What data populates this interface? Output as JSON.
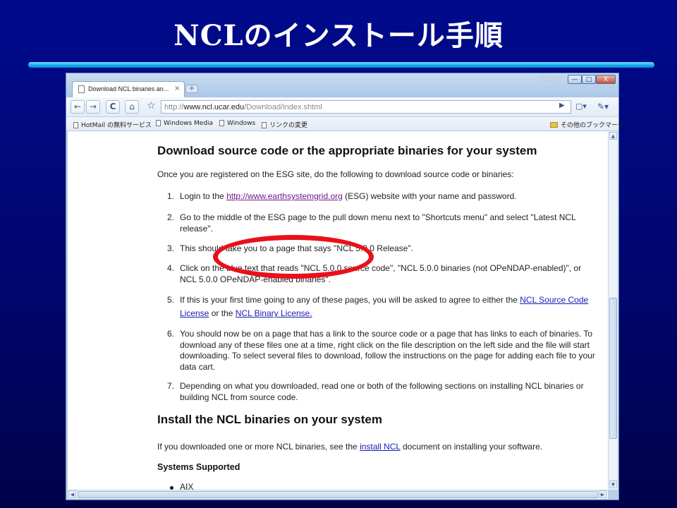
{
  "slide": {
    "title": "NCLのインストール手順"
  },
  "window": {
    "google_label": "Google",
    "minimize": "—",
    "maximize": "□",
    "close": "X"
  },
  "tab": {
    "label": "Download NCL binaries an...",
    "close": "×",
    "new_tab": "+"
  },
  "toolbar": {
    "back": "←",
    "forward": "→",
    "reload": "C",
    "home": "⌂",
    "star": "☆",
    "url_prefix": "http://",
    "url_host": "www.ncl.ucar.edu",
    "url_path": "/Download/index.shtml",
    "go": "▶",
    "page_menu": "▢▾",
    "tools_menu": "✎▾"
  },
  "bookmarks": {
    "items": [
      "HotMail の無料サービス",
      "Windows Media",
      "Windows",
      "リンクの変更"
    ],
    "other": "その他のブックマーク"
  },
  "content": {
    "heading1": "Download source code or the appropriate binaries for your system",
    "intro": "Once you are registered on the ESG site, do the following to download source code or binaries:",
    "step1": {
      "num": "1.",
      "before": "Login to the ",
      "link": "http://www.earthsystemgrid.org",
      "after": " (ESG) website with your name and password."
    },
    "step2": {
      "num": "2.",
      "line1": "Go to the middle of the ESG page to the pull down menu next to \"Shortcuts menu\" and select \"Latest NCL",
      "line2": "release\"."
    },
    "step3": {
      "num": "3.",
      "text": "This should take you to a page that says \"NCL 5.0.0 Release\"."
    },
    "step4": {
      "num": "4.",
      "line1": "Click on the blue text that reads \"NCL 5.0.0 source code\", \"NCL 5.0.0 binaries (not OPeNDAP-enabled)\", or",
      "line2": "NCL 5.0.0 OPeNDAP-enabled binaries\"."
    },
    "step5": {
      "num": "5.",
      "before": "If this is your first time going to any of these pages, you will be asked to agree to either the ",
      "link1a": "NCL Source Code",
      "link1b": "License",
      "middle": " or the ",
      "link2": "NCL Binary License."
    },
    "step6": {
      "num": "6.",
      "line1": "You should now be on a page that has a link to the source code or a page that has links to each of binaries. To",
      "line2": "download any of these files one at a time, right click on the file description on the left side and the file will start",
      "line3": "downloading. To select several files to download, follow the instructions on the page for adding each file to your",
      "line4": "data cart."
    },
    "step7": {
      "num": "7.",
      "line1": "Depending on what you downloaded, read one or both of the following sections on installing NCL binaries or",
      "line2": "building NCL from source code."
    },
    "heading2": "Install the NCL binaries on your system",
    "install_before": "If you downloaded one or more NCL binaries, see the ",
    "install_link": "install NCL",
    "install_after": " document on installing your software.",
    "heading3": "Systems Supported",
    "system1": "AIX"
  },
  "colors": {
    "slide_bg": "#000a8c",
    "accent_bar": "#18b4f0",
    "link": "#1a1ab8",
    "visited_link": "#6c1a8c",
    "highlight_circle": "#e8101a"
  }
}
